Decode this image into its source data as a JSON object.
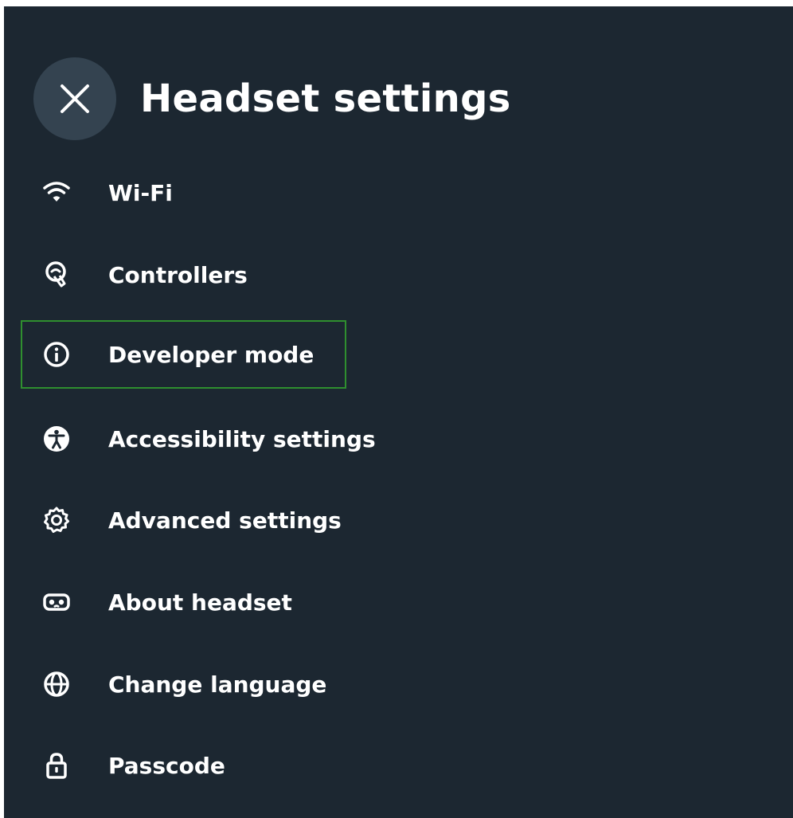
{
  "header": {
    "title": "Headset settings",
    "close_icon": "close-icon"
  },
  "menu": {
    "items": [
      {
        "label": "Wi-Fi",
        "icon": "wifi-icon"
      },
      {
        "label": "Controllers",
        "icon": "controller-icon"
      },
      {
        "label": "Developer mode",
        "icon": "info-icon",
        "highlighted": true
      },
      {
        "label": "Accessibility settings",
        "icon": "accessibility-icon"
      },
      {
        "label": "Advanced settings",
        "icon": "gear-icon"
      },
      {
        "label": "About headset",
        "icon": "headset-icon"
      },
      {
        "label": "Change language",
        "icon": "globe-icon"
      },
      {
        "label": "Passcode",
        "icon": "lock-icon"
      }
    ]
  },
  "colors": {
    "background": "#1c2731",
    "close_button": "#344350",
    "text": "#ffffff",
    "highlight_border": "#2f8f2f"
  }
}
